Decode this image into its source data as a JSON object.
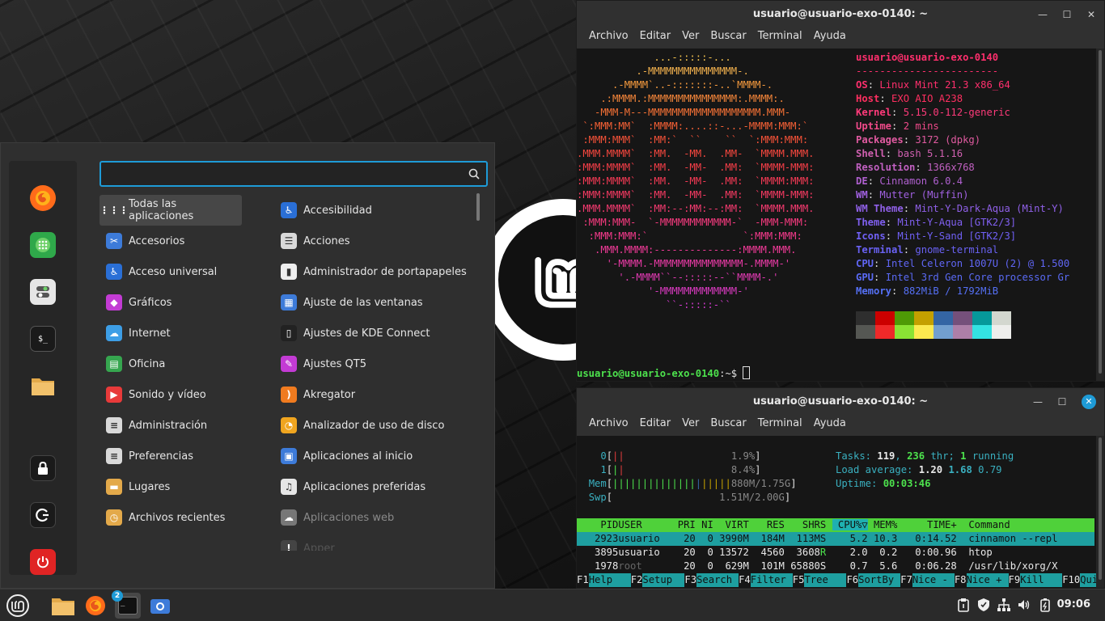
{
  "menu": {
    "search_placeholder": "",
    "favorites": [
      "firefox-icon",
      "software-manager-icon",
      "settings-icon",
      "terminal-icon",
      "files-icon",
      "lock-screen-icon",
      "logout-icon",
      "power-icon"
    ],
    "categories": [
      {
        "label": "Todas las aplicaciones",
        "icon": "grid"
      },
      {
        "label": "Accesorios",
        "icon": "scissors"
      },
      {
        "label": "Acceso universal",
        "icon": "accessibility"
      },
      {
        "label": "Gráficos",
        "icon": "graphics"
      },
      {
        "label": "Internet",
        "icon": "cloud"
      },
      {
        "label": "Oficina",
        "icon": "office"
      },
      {
        "label": "Sonido y vídeo",
        "icon": "play"
      },
      {
        "label": "Administración",
        "icon": "admin"
      },
      {
        "label": "Preferencias",
        "icon": "prefs"
      },
      {
        "label": "Lugares",
        "icon": "folder"
      },
      {
        "label": "Archivos recientes",
        "icon": "recent"
      }
    ],
    "apps": [
      {
        "label": "Accesibilidad",
        "icon": "accessibility"
      },
      {
        "label": "Acciones",
        "icon": "actions"
      },
      {
        "label": "Administrador de portapapeles",
        "icon": "clipboard"
      },
      {
        "label": "Ajuste de las ventanas",
        "icon": "windows"
      },
      {
        "label": "Ajustes de KDE Connect",
        "icon": "phone"
      },
      {
        "label": "Ajustes QT5",
        "icon": "qt"
      },
      {
        "label": "Akregator",
        "icon": "rss"
      },
      {
        "label": "Analizador de uso de disco",
        "icon": "disk"
      },
      {
        "label": "Aplicaciones al inicio",
        "icon": "startup"
      },
      {
        "label": "Aplicaciones preferidas",
        "icon": "preferred"
      },
      {
        "label": "Aplicaciones web",
        "icon": "webapps"
      },
      {
        "label": "Apper",
        "icon": "apper"
      }
    ]
  },
  "terminal1": {
    "title": "usuario@usuario-exo-0140: ~",
    "menu": [
      "Archivo",
      "Editar",
      "Ver",
      "Buscar",
      "Terminal",
      "Ayuda"
    ],
    "ascii_art": [
      "             ...-:::::-...",
      "          .-MMMMMMMMMMMMMMM-.",
      "      .-MMMM`..-:::::::-..`MMMM-.",
      "    .:MMMM.:MMMMMMMMMMMMMMM:.MMMM:.",
      "   -MMM-M---MMMMMMMMMMMMMMMMMMM.MMM-",
      " `:MMM:MM`  :MMMM:....::-...-MMMM:MMM:`",
      " :MMM:MMM`  :MM:`  ``    ``  `:MMM:MMM:",
      ".MMM.MMMM`  :MM.  -MM.  .MM-  `MMMM.MMM.",
      ":MMM:MMMM`  :MM.  -MM-  .MM:  `MMMM-MMM:",
      ":MMM:MMMM`  :MM.  -MM-  .MM:  `MMMM:MMM:",
      ":MMM:MMMM`  :MM.  -MM-  .MM:  `MMMM-MMM:",
      ".MMM.MMMM`  :MM:--:MM:--:MM:  `MMMM.MMM.",
      " :MMM:MMM-  `-MMMMMMMMMMMM-`  -MMM-MMM:",
      "  :MMM:MMM:`                `:MMM:MMM:",
      "   .MMM.MMMM:--------------:MMMM.MMM.",
      "     '-MMMM.-MMMMMMMMMMMMMMM-.MMMM-'",
      "       '.-MMMM``--:::::--``MMMM-.'",
      "            '-MMMMMMMMMMMMM-'",
      "               ``-:::::-``"
    ],
    "info_header": "usuario@usuario-exo-0140",
    "info_separator": "------------------------",
    "info": [
      {
        "key": "OS",
        "value": "Linux Mint 21.3 x86_64"
      },
      {
        "key": "Host",
        "value": "EXO AIO A238"
      },
      {
        "key": "Kernel",
        "value": "5.15.0-112-generic"
      },
      {
        "key": "Uptime",
        "value": "2 mins"
      },
      {
        "key": "Packages",
        "value": "3172 (dpkg)"
      },
      {
        "key": "Shell",
        "value": "bash 5.1.16"
      },
      {
        "key": "Resolution",
        "value": "1366x768"
      },
      {
        "key": "DE",
        "value": "Cinnamon 6.0.4"
      },
      {
        "key": "WM",
        "value": "Mutter (Muffin)"
      },
      {
        "key": "WM Theme",
        "value": "Mint-Y-Dark-Aqua (Mint-Y)"
      },
      {
        "key": "Theme",
        "value": "Mint-Y-Aqua [GTK2/3]"
      },
      {
        "key": "Icons",
        "value": "Mint-Y-Sand [GTK2/3]"
      },
      {
        "key": "Terminal",
        "value": "gnome-terminal"
      },
      {
        "key": "CPU",
        "value": "Intel Celeron 1007U (2) @ 1.500"
      },
      {
        "key": "GPU",
        "value": "Intel 3rd Gen Core processor Gr"
      },
      {
        "key": "Memory",
        "value": "882MiB / 1792MiB"
      }
    ],
    "palette_top": [
      "#2e2e2e",
      "#cc0000",
      "#4e9a06",
      "#c4a000",
      "#3465a4",
      "#75507b",
      "#06989a",
      "#d3d7cf"
    ],
    "palette_bottom": [
      "#555753",
      "#ef2929",
      "#8ae234",
      "#fce94f",
      "#729fcf",
      "#ad7fa8",
      "#34e2e2",
      "#eeeeec"
    ],
    "prompt_user": "usuario@usuario-exo-0140",
    "prompt_rest": ":~$ "
  },
  "terminal2": {
    "title": "usuario@usuario-exo-0140: ~",
    "menu": [
      "Archivo",
      "Editar",
      "Ver",
      "Buscar",
      "Terminal",
      "Ayuda"
    ],
    "cpu0_label": "0",
    "cpu0_pct": "1.9%",
    "cpu1_label": "1",
    "cpu1_pct": "8.4%",
    "mem_label": "Mem",
    "mem_value": "880M/1.75G",
    "swp_label": "Swp",
    "swp_value": "1.51M/2.00G",
    "tasks_label": "Tasks:",
    "tasks": "119",
    "thr": "236",
    "thr_label": "thr;",
    "running": "1",
    "running_label": "running",
    "load_label": "Load average:",
    "load1": "1.20",
    "load5": "1.68",
    "load15": "0.79",
    "uptime_label": "Uptime:",
    "uptime": "00:03:46",
    "columns": [
      "PID",
      "USER",
      "PRI",
      "NI",
      "VIRT",
      "RES",
      "SHR",
      "S",
      "CPU%▽",
      "MEM%",
      "TIME+",
      "Command"
    ],
    "processes": [
      {
        "pid": "2923",
        "user": "usuario",
        "pri": "20",
        "ni": "0",
        "virt": "3990M",
        "res": "184M",
        "shr": "113M",
        "s": "S",
        "cpu": "5.2",
        "mem": "10.3",
        "time": "0:14.52",
        "cmd": "cinnamon --repl"
      },
      {
        "pid": "3895",
        "user": "usuario",
        "pri": "20",
        "ni": "0",
        "virt": "13572",
        "res": "4560",
        "shr": "3608",
        "s": "R",
        "cpu": "2.0",
        "mem": "0.2",
        "time": "0:00.96",
        "cmd": "htop"
      },
      {
        "pid": "1978",
        "user": "root",
        "pri": "20",
        "ni": "0",
        "virt": "629M",
        "res": "101M",
        "shr": "65880",
        "s": "S",
        "cpu": "0.7",
        "mem": "5.6",
        "time": "0:06.28",
        "cmd": "/usr/lib/xorg/X"
      }
    ],
    "fkeys": [
      {
        "k": "F1",
        "l": "Help"
      },
      {
        "k": "F2",
        "l": "Setup"
      },
      {
        "k": "F3",
        "l": "Search"
      },
      {
        "k": "F4",
        "l": "Filter"
      },
      {
        "k": "F5",
        "l": "Tree"
      },
      {
        "k": "F6",
        "l": "SortBy"
      },
      {
        "k": "F7",
        "l": "Nice -"
      },
      {
        "k": "F8",
        "l": "Nice +"
      },
      {
        "k": "F9",
        "l": "Kill"
      },
      {
        "k": "F10",
        "l": "Quit"
      }
    ]
  },
  "taskbar": {
    "items": [
      "menu-icon",
      "files-icon",
      "firefox-icon",
      "terminal-icon",
      "screenshot-icon"
    ],
    "terminal_badge": "2",
    "tray": [
      "clipboard-icon",
      "shield-icon",
      "network-icon",
      "volume-icon",
      "battery-icon"
    ],
    "clock": "09:06"
  }
}
